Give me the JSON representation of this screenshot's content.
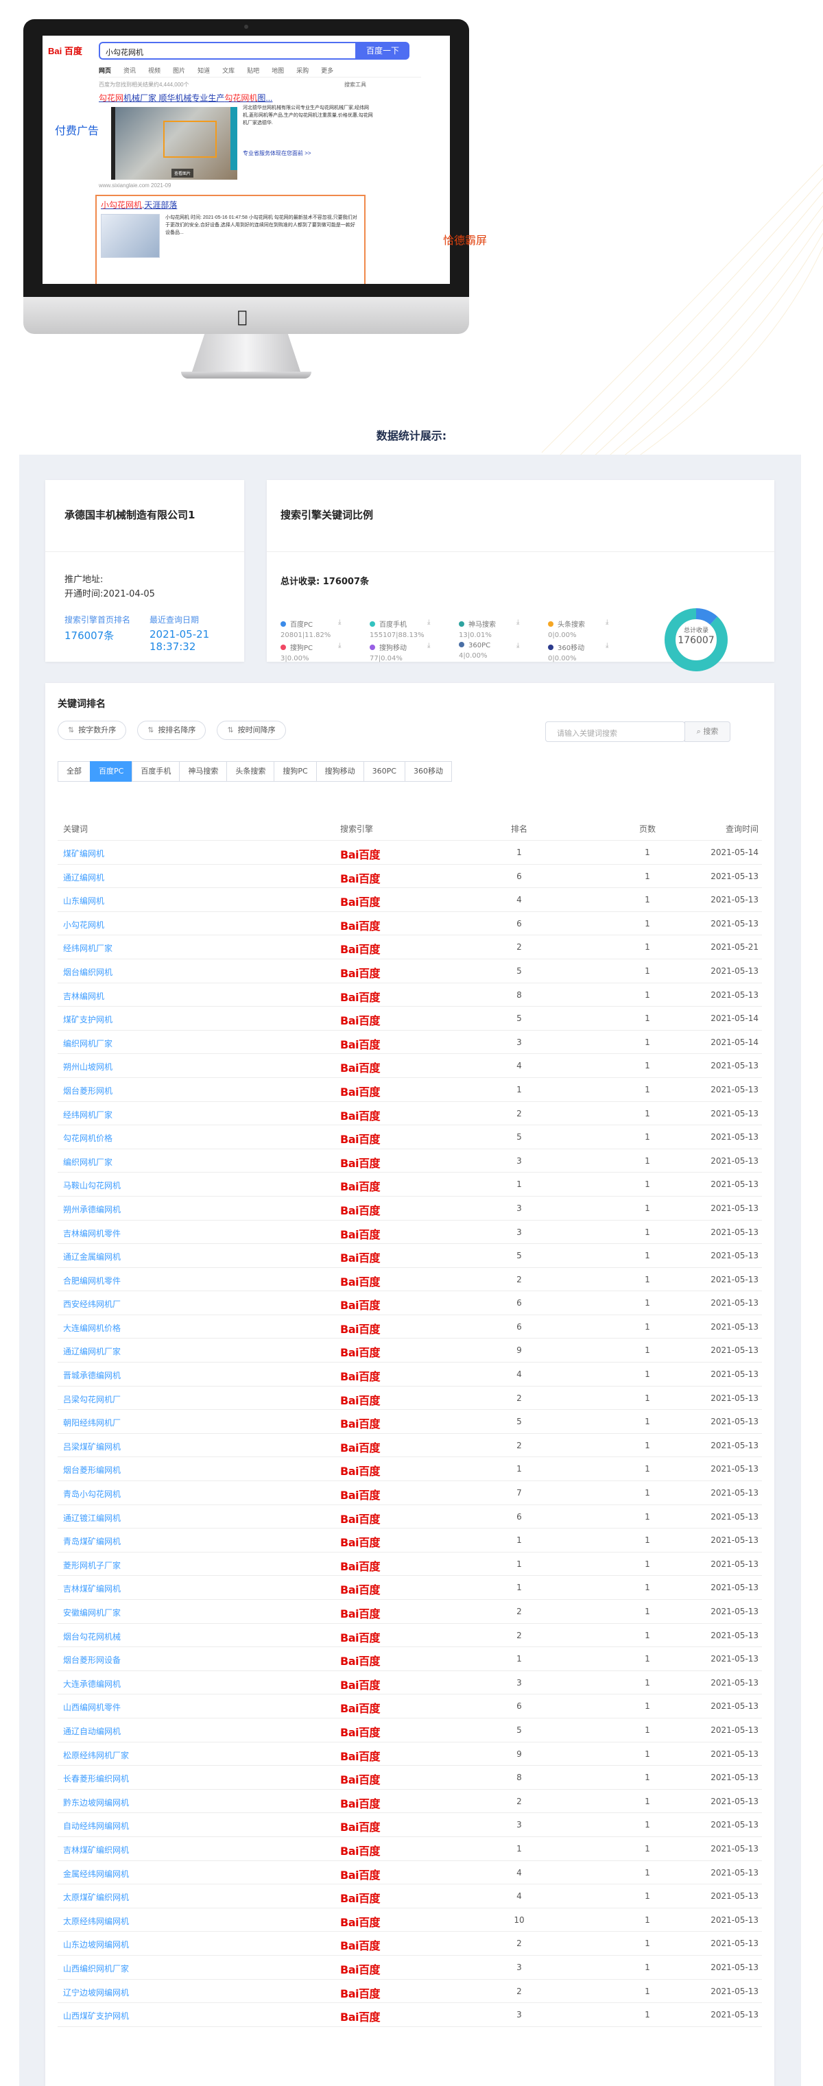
{
  "imac": {
    "search_query": "小勾花网机",
    "search_button": "百度一下",
    "logo": "Bai 百度",
    "tabs": [
      "网页",
      "资讯",
      "视频",
      "图片",
      "知道",
      "文库",
      "贴吧",
      "地图",
      "采购",
      "更多"
    ],
    "meta": "百度为您找到相关结果约4,444,000个",
    "tools": "搜索工具",
    "ad_label": "付费广告",
    "result1": {
      "title_pre": "勾花网",
      "title_mid": "机械厂家 顺华机械专业生产",
      "title_em": "勾花网机",
      "title_post": "图...",
      "text": "河北德华丝网机械有限公司专业生产勾花网机械厂家,经纬网机,菱形网机等产品,生产的勾花网机注重质量,价格优惠,勾花网机厂家选德华.",
      "link": "专业省服务体现在您面前 >>",
      "foot": "www.sixianglaie.com 2021-09",
      "caption": "查看图片"
    },
    "brand": {
      "title_em": "小勾花网机",
      "title_post": ",天涯部落",
      "text": "小勾花网机 时间: 2021-05-16 01:47:58 小勾花网机 勾花网的最新技术不容忽视,只要我们对于更改们的安全,合好设备,选择人用到好的连续同在到购准的人都到了要到做可能是一款好设备品..."
    },
    "brand_label": "恰德霸屏"
  },
  "section_title": "数据统计展示:",
  "company": {
    "name": "承德国丰机械制造有限公司1",
    "address_label": "推广地址:",
    "open_time_label": "开通时间:",
    "open_time": "2021-04-05",
    "first_page_label": "搜索引擎首页排名",
    "first_page_value": "176007条",
    "last_query_label": "最近查询日期",
    "last_query_value": "2021-05-21 18:37:32"
  },
  "ratio": {
    "title": "搜索引擎关键词比例",
    "total_label": "总计收录:",
    "total_value": "176007条",
    "donut_label": "总计收录",
    "donut_value": "176007",
    "engines": [
      {
        "name": "百度PC",
        "stat": "20801|11.82%",
        "color": "#3b8be9",
        "share": 0.1182
      },
      {
        "name": "百度手机",
        "stat": "155107|88.13%",
        "color": "#33c2bf",
        "share": 0.8813
      },
      {
        "name": "神马搜索",
        "stat": "13|0.01%",
        "color": "#2ea3a0",
        "share": 0.0001
      },
      {
        "name": "头条搜索",
        "stat": "0|0.00%",
        "color": "#f5a623",
        "share": 0.0
      },
      {
        "name": "搜狗PC",
        "stat": "3|0.00%",
        "color": "#f04864",
        "share": 0.0
      },
      {
        "name": "搜狗移动",
        "stat": "77|0.04%",
        "color": "#975fe4",
        "share": 0.0004
      },
      {
        "name": "360PC",
        "stat": "4|0.00%",
        "color": "#4a6fa5",
        "share": 0.0
      },
      {
        "name": "360移动",
        "stat": "0|0.00%",
        "color": "#2b3a8c",
        "share": 0.0
      }
    ]
  },
  "keywords": {
    "title": "关键词排名",
    "sort_buttons": [
      "按字数升序",
      "按排名降序",
      "按时间降序"
    ],
    "search_placeholder": "请输入关键词搜索",
    "search_button": "搜索",
    "filters": [
      "全部",
      "百度PC",
      "百度手机",
      "神马搜索",
      "头条搜索",
      "搜狗PC",
      "搜狗移动",
      "360PC",
      "360移动"
    ],
    "active_filter": "百度PC",
    "columns": [
      "关键词",
      "搜索引擎",
      "排名",
      "页数",
      "查询时间"
    ],
    "engine_logo": "Bai百度",
    "rows": [
      [
        "煤矿编网机",
        "1",
        "1",
        "2021-05-14"
      ],
      [
        "通辽编网机",
        "6",
        "1",
        "2021-05-13"
      ],
      [
        "山东编网机",
        "4",
        "1",
        "2021-05-13"
      ],
      [
        "小勾花网机",
        "6",
        "1",
        "2021-05-13"
      ],
      [
        "经纬网机厂家",
        "2",
        "1",
        "2021-05-21"
      ],
      [
        "烟台编织网机",
        "5",
        "1",
        "2021-05-13"
      ],
      [
        "吉林编网机",
        "8",
        "1",
        "2021-05-13"
      ],
      [
        "煤矿支护网机",
        "5",
        "1",
        "2021-05-14"
      ],
      [
        "编织网机厂家",
        "3",
        "1",
        "2021-05-14"
      ],
      [
        "朔州山坡网机",
        "4",
        "1",
        "2021-05-13"
      ],
      [
        "烟台菱形网机",
        "1",
        "1",
        "2021-05-13"
      ],
      [
        "经纬网机厂家",
        "2",
        "1",
        "2021-05-13"
      ],
      [
        "勾花网机价格",
        "5",
        "1",
        "2021-05-13"
      ],
      [
        "编织网机厂家",
        "3",
        "1",
        "2021-05-13"
      ],
      [
        "马鞍山勾花网机",
        "1",
        "1",
        "2021-05-13"
      ],
      [
        "朔州承德编网机",
        "3",
        "1",
        "2021-05-13"
      ],
      [
        "吉林编网机零件",
        "3",
        "1",
        "2021-05-13"
      ],
      [
        "通辽金属编网机",
        "5",
        "1",
        "2021-05-13"
      ],
      [
        "合肥编网机零件",
        "2",
        "1",
        "2021-05-13"
      ],
      [
        "西安经纬网机厂",
        "6",
        "1",
        "2021-05-13"
      ],
      [
        "大连编网机价格",
        "6",
        "1",
        "2021-05-13"
      ],
      [
        "通辽编网机厂家",
        "9",
        "1",
        "2021-05-13"
      ],
      [
        "晋城承德编网机",
        "4",
        "1",
        "2021-05-13"
      ],
      [
        "吕梁勾花网机厂",
        "2",
        "1",
        "2021-05-13"
      ],
      [
        "朝阳经纬网机厂",
        "5",
        "1",
        "2021-05-13"
      ],
      [
        "吕梁煤矿编网机",
        "2",
        "1",
        "2021-05-13"
      ],
      [
        "烟台菱形编网机",
        "1",
        "1",
        "2021-05-13"
      ],
      [
        "青岛小勾花网机",
        "7",
        "1",
        "2021-05-13"
      ],
      [
        "通辽镀江编网机",
        "6",
        "1",
        "2021-05-13"
      ],
      [
        "青岛煤矿编网机",
        "1",
        "1",
        "2021-05-13"
      ],
      [
        "菱形网机子厂家",
        "1",
        "1",
        "2021-05-13"
      ],
      [
        "吉林煤矿编网机",
        "1",
        "1",
        "2021-05-13"
      ],
      [
        "安徽编网机厂家",
        "2",
        "1",
        "2021-05-13"
      ],
      [
        "烟台勾花网机械",
        "2",
        "1",
        "2021-05-13"
      ],
      [
        "烟台菱形网设备",
        "1",
        "1",
        "2021-05-13"
      ],
      [
        "大连承德编网机",
        "3",
        "1",
        "2021-05-13"
      ],
      [
        "山西编网机零件",
        "6",
        "1",
        "2021-05-13"
      ],
      [
        "通辽自动编网机",
        "5",
        "1",
        "2021-05-13"
      ],
      [
        "松原经纬网机厂家",
        "9",
        "1",
        "2021-05-13"
      ],
      [
        "长春菱形编织网机",
        "8",
        "1",
        "2021-05-13"
      ],
      [
        "黔东边坡网编网机",
        "2",
        "1",
        "2021-05-13"
      ],
      [
        "自动经纬网编网机",
        "3",
        "1",
        "2021-05-13"
      ],
      [
        "吉林煤矿编织网机",
        "1",
        "1",
        "2021-05-13"
      ],
      [
        "金属经纬网编网机",
        "4",
        "1",
        "2021-05-13"
      ],
      [
        "太原煤矿编织网机",
        "4",
        "1",
        "2021-05-13"
      ],
      [
        "太原经纬网编网机",
        "10",
        "1",
        "2021-05-13"
      ],
      [
        "山东边坡网编网机",
        "2",
        "1",
        "2021-05-13"
      ],
      [
        "山西编织网机厂家",
        "3",
        "1",
        "2021-05-13"
      ],
      [
        "辽宁边坡网编网机",
        "2",
        "1",
        "2021-05-13"
      ],
      [
        "山西煤矿支护网机",
        "3",
        "1",
        "2021-05-13"
      ]
    ]
  }
}
